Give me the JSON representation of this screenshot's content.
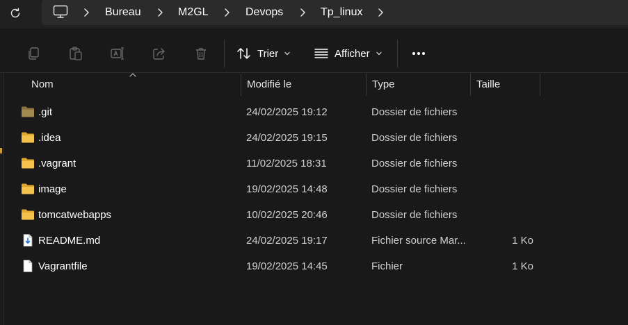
{
  "breadcrumb": {
    "items": [
      "Bureau",
      "M2GL",
      "Devops",
      "Tp_linux"
    ]
  },
  "toolbar": {
    "sort_label": "Trier",
    "view_label": "Afficher"
  },
  "columns": {
    "name": "Nom",
    "modified": "Modifié le",
    "type": "Type",
    "size": "Taille"
  },
  "files": [
    {
      "name": ".git",
      "modified": "24/02/2025 19:12",
      "type": "Dossier de fichiers",
      "size": "",
      "icon": "folder-dim-icon"
    },
    {
      "name": ".idea",
      "modified": "24/02/2025 19:15",
      "type": "Dossier de fichiers",
      "size": "",
      "icon": "folder-icon"
    },
    {
      "name": ".vagrant",
      "modified": "11/02/2025 18:31",
      "type": "Dossier de fichiers",
      "size": "",
      "icon": "folder-icon"
    },
    {
      "name": "image",
      "modified": "19/02/2025 14:48",
      "type": "Dossier de fichiers",
      "size": "",
      "icon": "folder-icon"
    },
    {
      "name": "tomcatwebapps",
      "modified": "10/02/2025 20:46",
      "type": "Dossier de fichiers",
      "size": "",
      "icon": "folder-icon"
    },
    {
      "name": "README.md",
      "modified": "24/02/2025 19:17",
      "type": "Fichier source Mar...",
      "size": "1 Ko",
      "icon": "markdown-file-icon"
    },
    {
      "name": "Vagrantfile",
      "modified": "19/02/2025 14:45",
      "type": "Fichier",
      "size": "1 Ko",
      "icon": "file-icon"
    }
  ],
  "colors": {
    "folder": "#f4c24c",
    "folder_dim": "#8a7440",
    "accent": "#4cc2ff"
  }
}
